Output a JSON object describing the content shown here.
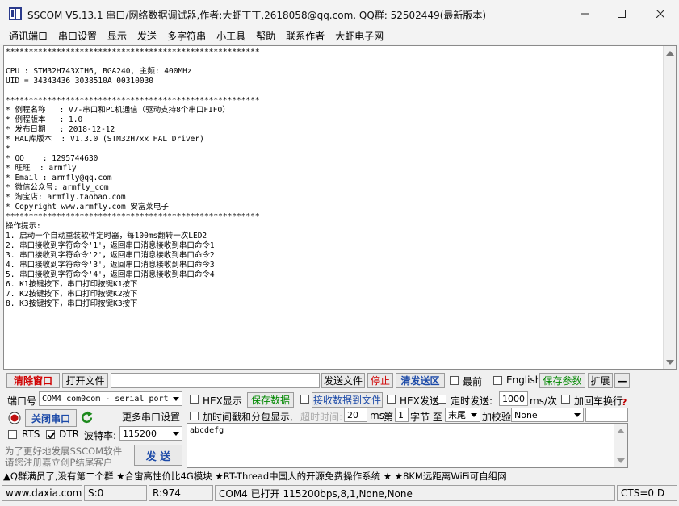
{
  "window": {
    "title": "SSCOM V5.13.1 串口/网络数据调试器,作者:大虾丁丁,2618058@qq.com. QQ群: 52502449(最新版本)"
  },
  "menu": [
    "通讯端口",
    "串口设置",
    "显示",
    "发送",
    "多字符串",
    "小工具",
    "帮助",
    "联系作者",
    "大虾电子网"
  ],
  "receive": {
    "lines": [
      "*******************************************************",
      "",
      "CPU : STM32H743XIH6, BGA240, 主频: 400MHz",
      "UID = 34343436 3038510A 00310030",
      "",
      "*******************************************************",
      "* 例程名称   : V7-串口和PC机通信（驱动支持8个串口FIFO）",
      "* 例程版本   : 1.0",
      "* 发布日期   : 2018-12-12",
      "* HAL库版本  : V1.3.0 (STM32H7xx HAL Driver)",
      "*",
      "* QQ    : 1295744630",
      "* 旺旺  : armfly",
      "* Email : armfly@qq.com",
      "* 微信公众号: armfly_com",
      "* 淘宝店: armfly.taobao.com",
      "* Copyright www.armfly.com 安富莱电子",
      "*******************************************************",
      "操作提示:",
      "1. 启动一个自动重装软件定时器，每100ms翻转一次LED2",
      "2. 串口接收到字符命令'1'，返回串口消息接收到串口命令1",
      "3. 串口接收到字符命令'2'，返回串口消息接收到串口命令2",
      "4. 串口接收到字符命令'3'，返回串口消息接收到串口命令3",
      "5. 串口接收到字符命令'4'，返回串口消息接收到串口命令4",
      "6. K1按键按下，串口打印按键K1按下",
      "7. K2按键按下，串口打印按键K2按下",
      "8. K3按键按下，串口打印按键K3按下"
    ]
  },
  "toolbar": {
    "clear": "清除窗口",
    "open_file": "打开文件",
    "file_path": "",
    "send_file": "发送文件",
    "stop": "停止",
    "clear_send": "清发送区",
    "topmost": "最前",
    "english": "English",
    "save_params": "保存参数",
    "expand": "扩展",
    "collapse": "—"
  },
  "port": {
    "label": "端口号",
    "value": "COM4 com0com - serial port",
    "close_port": "关闭串口",
    "more_settings": "更多串口设置",
    "rts": "RTS",
    "dtr": "DTR",
    "baud_label": "波特率:",
    "baud": "115200",
    "promo1": "为了更好地发展SSCOM软件",
    "promo2": "请您注册嘉立创P结尾客户",
    "send": "发 送"
  },
  "options": {
    "hex_display": "HEX显示",
    "save_data": "保存数据",
    "recv_to_file": "接收数据到文件",
    "hex_send": "HEX发送",
    "timed_send": "定时发送:",
    "interval": "1000",
    "interval_unit": "ms/次",
    "add_crlf": "加回车换行",
    "help": "?",
    "timestamp": "加时间戳和分包显示,",
    "timeout_label": "超时时间:",
    "timeout": "20",
    "ms": "ms",
    "nth": "第",
    "byte_from": "1",
    "byte_label": "字节 至",
    "byte_to": "末尾",
    "checksum_label": "加校验",
    "checksum": "None"
  },
  "send_box": {
    "text": "abcdefg"
  },
  "marquee": "▲Q群满员了,没有第二个群 ★合宙高性价比4G模块 ★RT-Thread中国人的开源免费操作系统 ★ ★8KM远距离WiFi可自组网",
  "status": {
    "site": "www.daxia.com",
    "sent": "S:0",
    "recv": "R:974",
    "port_info": "COM4 已打开  115200bps,8,1,None,None",
    "cts": "CTS=0 D"
  },
  "colors": {
    "clear_red": "#d00000",
    "green": "#008800",
    "blue": "#1c4aa8"
  }
}
